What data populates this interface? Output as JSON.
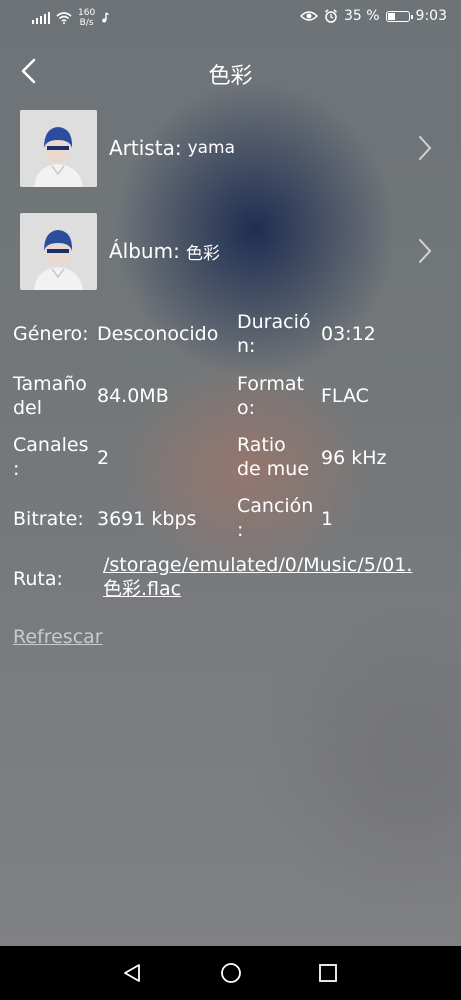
{
  "status_bar": {
    "net_speed_value": "160",
    "net_speed_unit": "B/s",
    "battery_percent": "35 %",
    "battery_level": 0.35,
    "time": "9:03"
  },
  "header": {
    "title": "色彩"
  },
  "artist": {
    "label": "Artista:",
    "value": "yama"
  },
  "album": {
    "label": "Álbum:",
    "value": "色彩"
  },
  "details": {
    "genre_label": "Género:",
    "genre_value": "Desconocido",
    "duration_label_line1": "Duració",
    "duration_label_line2": "n:",
    "duration_value": "03:12",
    "size_label_line1": "Tamaño",
    "size_label_line2": "del",
    "size_value": "84.0MB",
    "format_label_line1": "Format",
    "format_label_line2": "o:",
    "format_value": "FLAC",
    "channels_label_line1": "Canales",
    "channels_label_line2": ":",
    "channels_value": "2",
    "samplerate_label_line1": "Ratio",
    "samplerate_label_line2": "de mue",
    "samplerate_value": "96 kHz",
    "bitrate_label": "Bitrate:",
    "bitrate_value": "3691 kbps",
    "track_label_line1": "Canción",
    "track_label_line2": ":",
    "track_value": "1",
    "path_label": "Ruta:",
    "path_value_line1": "/storage/emulated/0/Music/5/01.",
    "path_value_line2": "色彩.flac"
  },
  "actions": {
    "refresh_label": "Refrescar"
  }
}
